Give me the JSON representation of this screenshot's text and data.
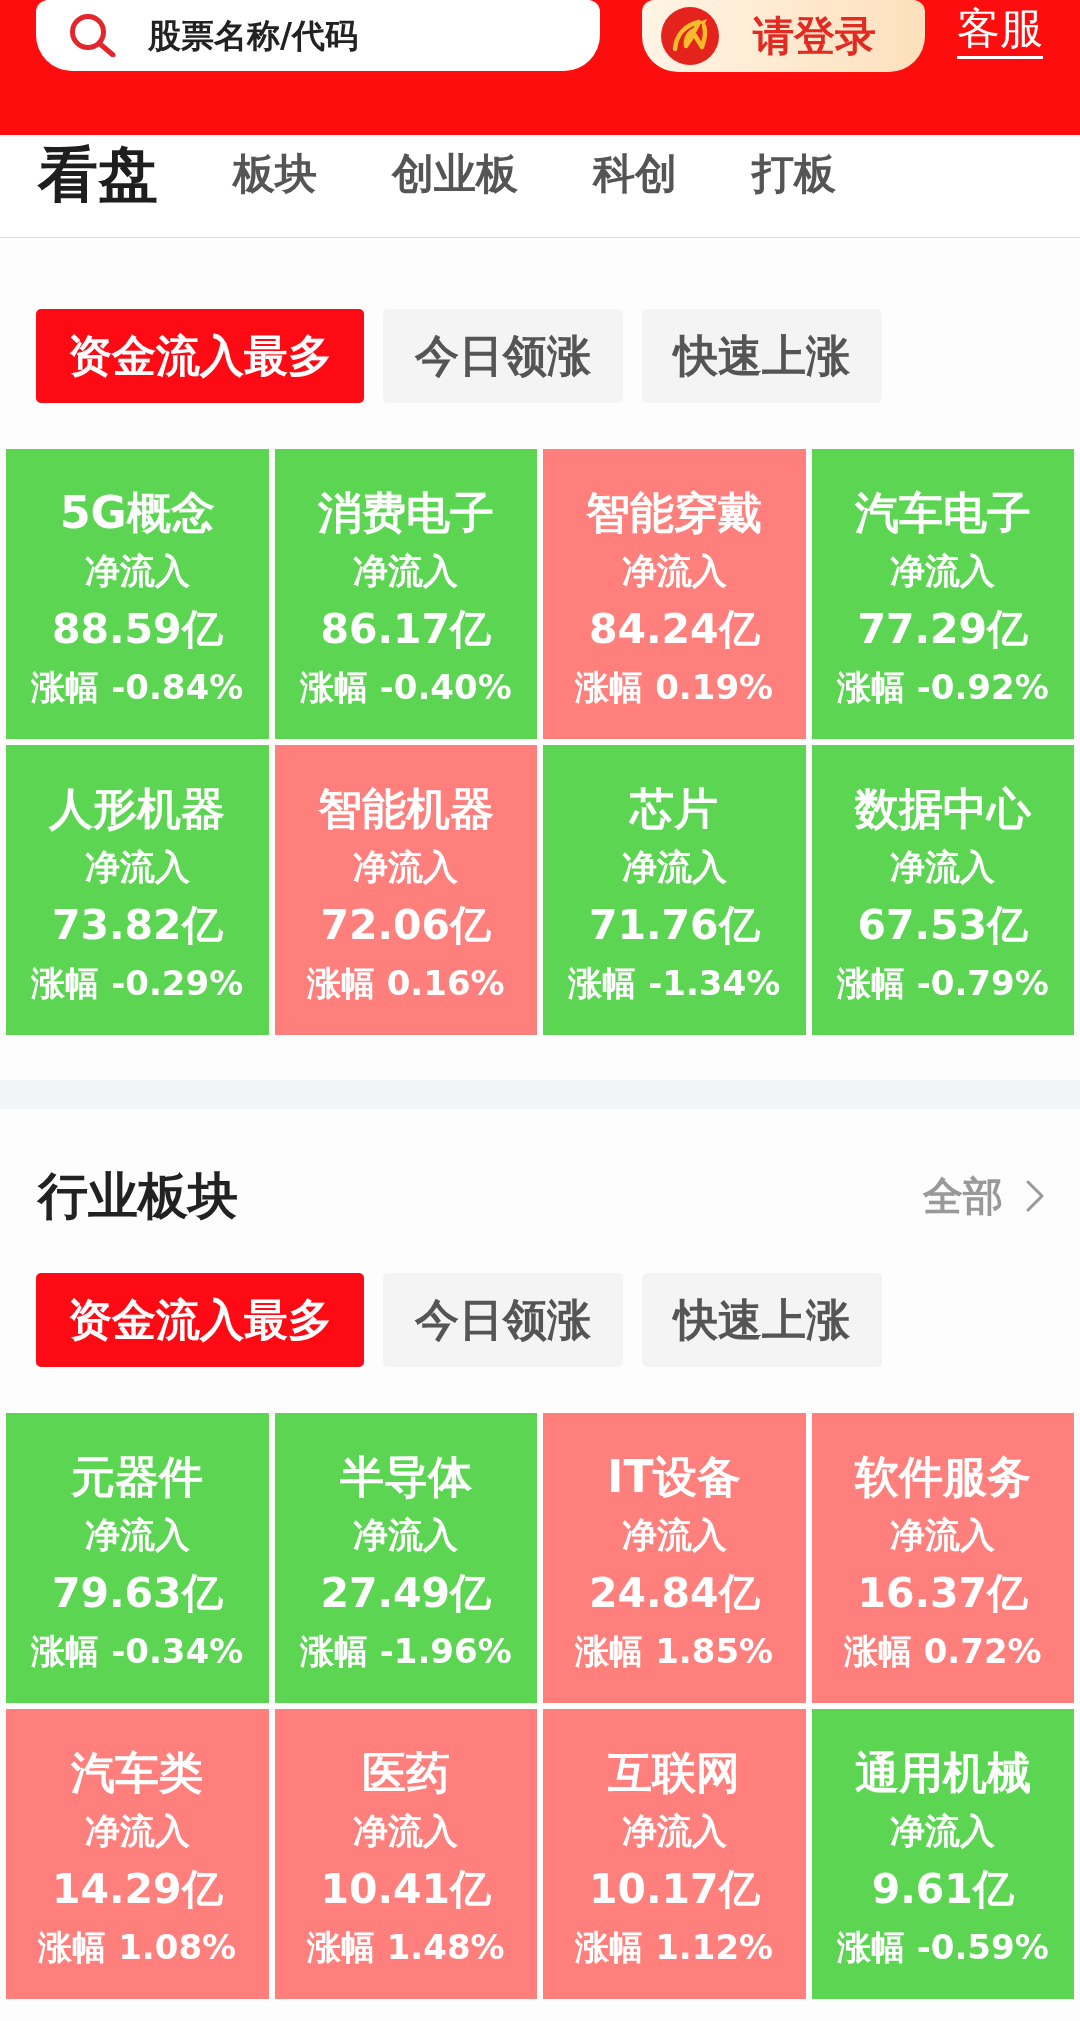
{
  "header": {
    "search": {
      "placeholder": "股票名称/代码"
    },
    "login_button": "请登录",
    "service_link": "客服"
  },
  "nav_tabs": [
    {
      "label": "看盘",
      "selected": true
    },
    {
      "label": "板块",
      "selected": false
    },
    {
      "label": "创业板",
      "selected": false
    },
    {
      "label": "科创",
      "selected": false
    },
    {
      "label": "打板",
      "selected": false
    }
  ],
  "sections": [
    {
      "filters": [
        {
          "label": "资金流入最多",
          "selected": true
        },
        {
          "label": "今日领涨",
          "selected": false
        },
        {
          "label": "快速上涨",
          "selected": false
        }
      ],
      "tiles": [
        {
          "name": "5G概念",
          "flow_label": "净流入",
          "amount": "88.59亿",
          "change": "涨幅 -0.84%",
          "color": "#5cd552"
        },
        {
          "name": "消费电子",
          "flow_label": "净流入",
          "amount": "86.17亿",
          "change": "涨幅 -0.40%",
          "color": "#5cd552"
        },
        {
          "name": "智能穿戴",
          "flow_label": "净流入",
          "amount": "84.24亿",
          "change": "涨幅 0.19%",
          "color": "#fe7f7b"
        },
        {
          "name": "汽车电子",
          "flow_label": "净流入",
          "amount": "77.29亿",
          "change": "涨幅 -0.92%",
          "color": "#5cd552"
        },
        {
          "name": "人形机器",
          "flow_label": "净流入",
          "amount": "73.82亿",
          "change": "涨幅 -0.29%",
          "color": "#5cd552"
        },
        {
          "name": "智能机器",
          "flow_label": "净流入",
          "amount": "72.06亿",
          "change": "涨幅 0.16%",
          "color": "#fe7f7b"
        },
        {
          "name": "芯片",
          "flow_label": "净流入",
          "amount": "71.76亿",
          "change": "涨幅 -1.34%",
          "color": "#5cd552"
        },
        {
          "name": "数据中心",
          "flow_label": "净流入",
          "amount": "67.53亿",
          "change": "涨幅 -0.79%",
          "color": "#5cd552"
        }
      ]
    },
    {
      "title": "行业板块",
      "more_link": "全部",
      "filters": [
        {
          "label": "资金流入最多",
          "selected": true
        },
        {
          "label": "今日领涨",
          "selected": false
        },
        {
          "label": "快速上涨",
          "selected": false
        }
      ],
      "tiles": [
        {
          "name": "元器件",
          "flow_label": "净流入",
          "amount": "79.63亿",
          "change": "涨幅 -0.34%",
          "color": "#5cd552"
        },
        {
          "name": "半导体",
          "flow_label": "净流入",
          "amount": "27.49亿",
          "change": "涨幅 -1.96%",
          "color": "#5cd552"
        },
        {
          "name": "IT设备",
          "flow_label": "净流入",
          "amount": "24.84亿",
          "change": "涨幅 1.85%",
          "color": "#fe7f7b"
        },
        {
          "name": "软件服务",
          "flow_label": "净流入",
          "amount": "16.37亿",
          "change": "涨幅 0.72%",
          "color": "#fe7f7b"
        },
        {
          "name": "汽车类",
          "flow_label": "净流入",
          "amount": "14.29亿",
          "change": "涨幅 1.08%",
          "color": "#fe7f7b"
        },
        {
          "name": "医药",
          "flow_label": "净流入",
          "amount": "10.41亿",
          "change": "涨幅 1.48%",
          "color": "#fe7f7b"
        },
        {
          "name": "互联网",
          "flow_label": "净流入",
          "amount": "10.17亿",
          "change": "涨幅 1.12%",
          "color": "#fe7f7b"
        },
        {
          "name": "通用机械",
          "flow_label": "净流入",
          "amount": "9.61亿",
          "change": "涨幅 -0.59%",
          "color": "#5cd552"
        }
      ]
    }
  ]
}
